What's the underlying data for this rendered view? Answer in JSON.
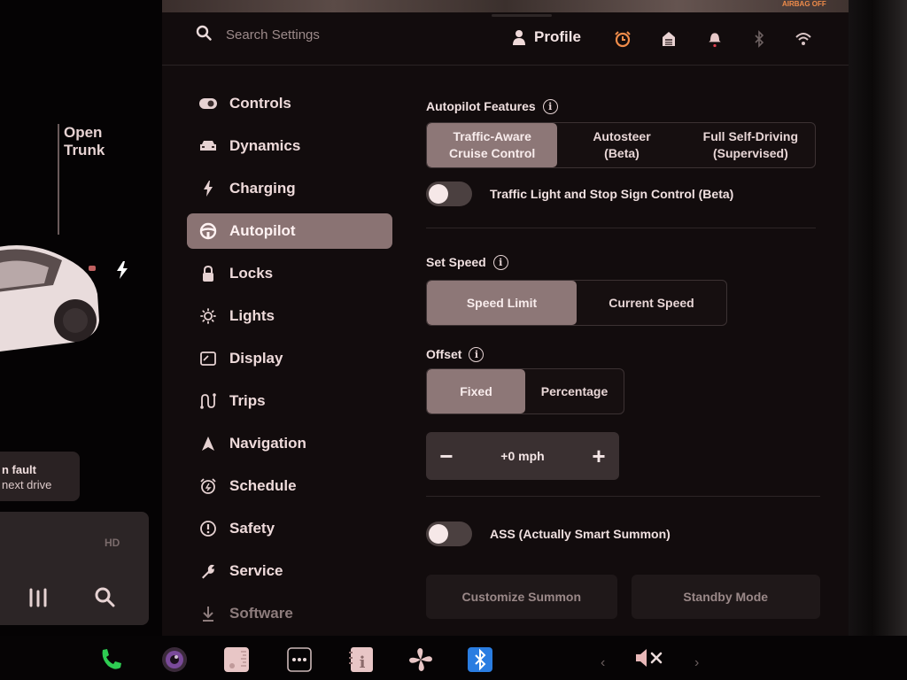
{
  "car_view": {
    "trunk_label_line1": "Open",
    "trunk_label_line2": "Trunk",
    "alert_line1": "n fault",
    "alert_line2": "next drive",
    "media_badge": "HD"
  },
  "header": {
    "search_placeholder": "Search Settings",
    "profile_label": "Profile",
    "status_text": "AIRBAG OFF",
    "icons": [
      "alarm-clock-icon",
      "garage-icon",
      "bell-icon",
      "bluetooth-icon",
      "wifi-icon"
    ]
  },
  "sidebar": {
    "items": [
      {
        "label": "Controls",
        "icon": "toggle-icon"
      },
      {
        "label": "Dynamics",
        "icon": "car-icon"
      },
      {
        "label": "Charging",
        "icon": "lightning-icon"
      },
      {
        "label": "Autopilot",
        "icon": "steering-wheel-icon",
        "active": true
      },
      {
        "label": "Locks",
        "icon": "lock-icon"
      },
      {
        "label": "Lights",
        "icon": "sun-icon"
      },
      {
        "label": "Display",
        "icon": "display-icon"
      },
      {
        "label": "Trips",
        "icon": "route-icon"
      },
      {
        "label": "Navigation",
        "icon": "navigation-arrow-icon"
      },
      {
        "label": "Schedule",
        "icon": "schedule-clock-icon"
      },
      {
        "label": "Safety",
        "icon": "exclamation-circle-icon"
      },
      {
        "label": "Service",
        "icon": "wrench-icon"
      },
      {
        "label": "Software",
        "icon": "download-icon"
      }
    ]
  },
  "autopilot": {
    "features_title": "Autopilot Features",
    "features_options": [
      {
        "line1": "Traffic-Aware",
        "line2": "Cruise Control",
        "selected": true
      },
      {
        "line1": "Autosteer",
        "line2": "(Beta)",
        "selected": false
      },
      {
        "line1": "Full Self-Driving",
        "line2": "(Supervised)",
        "selected": false
      }
    ],
    "traffic_light_toggle_label": "Traffic Light and Stop Sign Control (Beta)",
    "traffic_light_toggle_on": false,
    "set_speed_title": "Set Speed",
    "set_speed_options": [
      {
        "label": "Speed Limit",
        "selected": true
      },
      {
        "label": "Current Speed",
        "selected": false
      }
    ],
    "offset_title": "Offset",
    "offset_options": [
      {
        "label": "Fixed",
        "selected": true
      },
      {
        "label": "Percentage",
        "selected": false
      }
    ],
    "offset_value": "+0 mph",
    "offset_minus": "−",
    "offset_plus": "+",
    "summon_toggle_label": "ASS (Actually Smart Summon)",
    "summon_toggle_on": false,
    "customize_summon_label": "Customize Summon",
    "standby_mode_label": "Standby Mode"
  },
  "dock": {
    "icons": [
      "phone-icon",
      "camera-icon",
      "toybox-icon",
      "more-apps-icon",
      "manual-icon",
      "fan-icon",
      "bluetooth-app-icon"
    ],
    "prev": "‹",
    "next": "›",
    "volume_state": "muted"
  },
  "colors": {
    "accent_selected": "#8d7777",
    "panel_bg": "#120c0d",
    "alarm_orange": "#f08c4a",
    "phone_green": "#2ecc52",
    "bluetooth_blue": "#2a7de1"
  }
}
